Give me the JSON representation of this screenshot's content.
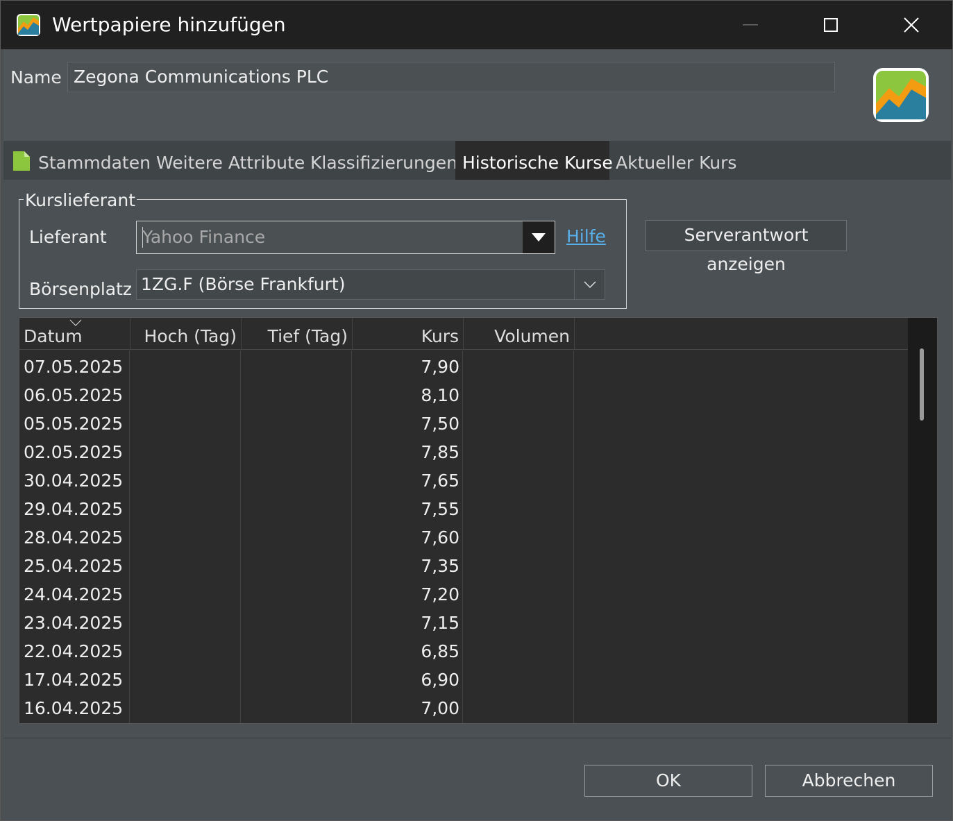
{
  "window": {
    "title": "Wertpapiere hinzufügen"
  },
  "header": {
    "name_label": "Name",
    "name_value": "Zegona Communications PLC"
  },
  "tabs": [
    {
      "label": "Stammdaten",
      "active": false
    },
    {
      "label": "Weitere Attribute",
      "active": false
    },
    {
      "label": "Klassifizierungen",
      "active": false
    },
    {
      "label": "Historische Kurse",
      "active": true
    },
    {
      "label": "Aktueller Kurs",
      "active": false
    }
  ],
  "provider": {
    "group_label": "Kurslieferant",
    "lieferant_label": "Lieferant",
    "lieferant_value": "Yahoo Finance",
    "help_link": "Hilfe",
    "boersenplatz_label": "Börsenplatz",
    "boersenplatz_value": "1ZG.F (Börse Frankfurt)",
    "server_button": "Serverantwort anzeigen"
  },
  "table": {
    "columns": [
      "Datum",
      "Hoch (Tag)",
      "Tief (Tag)",
      "Kurs",
      "Volumen"
    ],
    "rows": [
      {
        "datum": "07.05.2025",
        "hoch": "",
        "tief": "",
        "kurs": "7,90",
        "volumen": ""
      },
      {
        "datum": "06.05.2025",
        "hoch": "",
        "tief": "",
        "kurs": "8,10",
        "volumen": ""
      },
      {
        "datum": "05.05.2025",
        "hoch": "",
        "tief": "",
        "kurs": "7,50",
        "volumen": ""
      },
      {
        "datum": "02.05.2025",
        "hoch": "",
        "tief": "",
        "kurs": "7,85",
        "volumen": ""
      },
      {
        "datum": "30.04.2025",
        "hoch": "",
        "tief": "",
        "kurs": "7,65",
        "volumen": ""
      },
      {
        "datum": "29.04.2025",
        "hoch": "",
        "tief": "",
        "kurs": "7,55",
        "volumen": ""
      },
      {
        "datum": "28.04.2025",
        "hoch": "",
        "tief": "",
        "kurs": "7,60",
        "volumen": ""
      },
      {
        "datum": "25.04.2025",
        "hoch": "",
        "tief": "",
        "kurs": "7,35",
        "volumen": ""
      },
      {
        "datum": "24.04.2025",
        "hoch": "",
        "tief": "",
        "kurs": "7,20",
        "volumen": ""
      },
      {
        "datum": "23.04.2025",
        "hoch": "",
        "tief": "",
        "kurs": "7,15",
        "volumen": ""
      },
      {
        "datum": "22.04.2025",
        "hoch": "",
        "tief": "",
        "kurs": "6,85",
        "volumen": ""
      },
      {
        "datum": "17.04.2025",
        "hoch": "",
        "tief": "",
        "kurs": "6,90",
        "volumen": ""
      },
      {
        "datum": "16.04.2025",
        "hoch": "",
        "tief": "",
        "kurs": "7,00",
        "volumen": ""
      }
    ]
  },
  "footer": {
    "ok": "OK",
    "cancel": "Abbrechen"
  },
  "icons": {
    "app": "portfolio-chart-icon",
    "brand": "portfolio-chart-icon",
    "tab_document": "document-icon"
  },
  "colors": {
    "link": "#58aee8",
    "icon_green": "#8cc63e",
    "icon_orange": "#f39c12",
    "icon_teal": "#2a7f9e"
  }
}
